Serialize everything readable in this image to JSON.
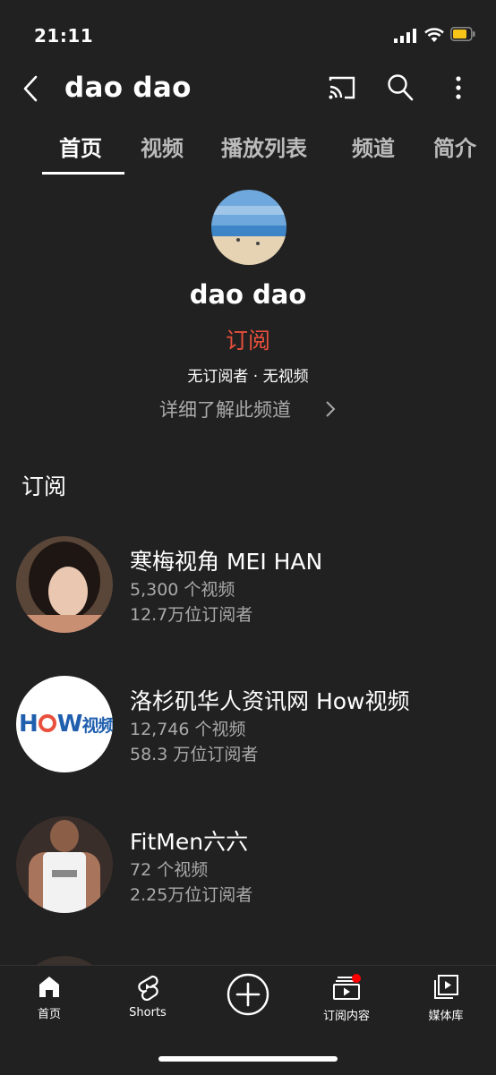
{
  "status_bar": {
    "time": "21:11"
  },
  "header": {
    "title": "dao dao"
  },
  "tabs": [
    {
      "label": "首页",
      "active": true
    },
    {
      "label": "视频"
    },
    {
      "label": "播放列表"
    },
    {
      "label": "频道"
    },
    {
      "label": "简介"
    }
  ],
  "channel": {
    "name": "dao dao",
    "subscribe_label": "订阅",
    "stats": "无订阅者 · 无视频",
    "more_link": "详细了解此频道"
  },
  "subscriptions": {
    "section_title": "订阅",
    "items": [
      {
        "name": "寒梅视角 MEI HAN",
        "videos": "5,300 个视频",
        "subscribers": "12.7万位订阅者"
      },
      {
        "name": "洛杉矶华人资讯网 How视频",
        "videos": "12,746 个视频",
        "subscribers": "58.3 万位订阅者",
        "logo_text": "H",
        "logo_text2": "W",
        "logo_text3": "视频"
      },
      {
        "name": "FitMen六六",
        "videos": "72 个视频",
        "subscribers": "2.25万位订阅者"
      }
    ]
  },
  "bottom_nav": [
    {
      "label": "首页",
      "icon": "home-icon"
    },
    {
      "label": "Shorts",
      "icon": "shorts-icon"
    },
    {
      "label": "",
      "icon": "create-icon"
    },
    {
      "label": "订阅内容",
      "icon": "subscriptions-icon"
    },
    {
      "label": "媒体库",
      "icon": "library-icon"
    }
  ],
  "colors": {
    "accent_red": "#e8503c",
    "background": "#212121"
  }
}
